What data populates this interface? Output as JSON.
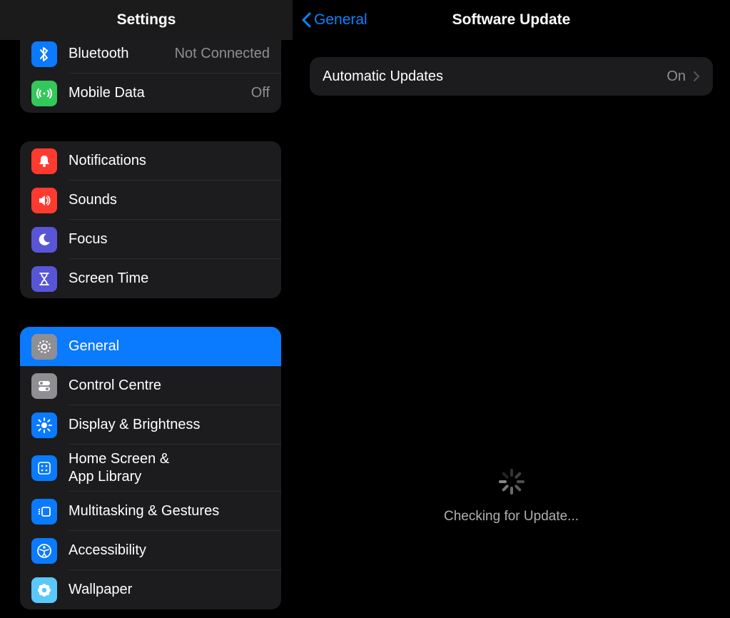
{
  "sidebar": {
    "title": "Settings",
    "groups": [
      {
        "rows": [
          {
            "label": "Bluetooth",
            "status": "Not Connected"
          },
          {
            "label": "Mobile Data",
            "status": "Off"
          }
        ]
      },
      {
        "rows": [
          {
            "label": "Notifications"
          },
          {
            "label": "Sounds"
          },
          {
            "label": "Focus"
          },
          {
            "label": "Screen Time"
          }
        ]
      },
      {
        "rows": [
          {
            "label": "General"
          },
          {
            "label": "Control Centre"
          },
          {
            "label": "Display & Brightness"
          },
          {
            "label": "Home Screen &\nApp Library"
          },
          {
            "label": "Multitasking & Gestures"
          },
          {
            "label": "Accessibility"
          },
          {
            "label": "Wallpaper"
          }
        ]
      }
    ]
  },
  "detail": {
    "back_label": "General",
    "title": "Software Update",
    "rows": [
      {
        "label": "Automatic Updates",
        "status": "On"
      }
    ],
    "checking_label": "Checking for Update..."
  }
}
